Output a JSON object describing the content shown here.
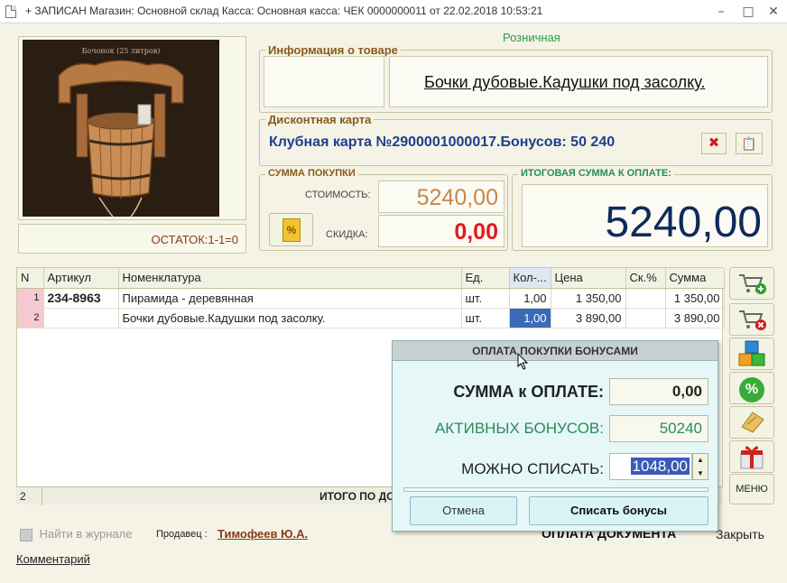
{
  "window": {
    "title": "+ ЗАПИСАН Магазин: Основной склад Касса: Основная касса: ЧЕК 0000000011 от 22.02.2018 10:53:21",
    "minimize": "–",
    "maximize": "□",
    "close": "✕"
  },
  "price_type": "Розничная",
  "product": {
    "photo_caption": "Бочонок (25 литров)",
    "stock_text": "ОСТАТОК:1-1=0",
    "info_legend": "Информация о товаре",
    "name": "Бочки дубовые.Кадушки под засолку."
  },
  "discount_card": {
    "legend": "Дисконтная карта",
    "text": "Клубная карта №2900001000017.Бонусов: 50 240"
  },
  "purchase": {
    "legend": "СУММА ПОКУПКИ",
    "cost_label": "СТОИМОСТЬ:",
    "cost_value": "5240,00",
    "discount_label": "СКИДКА:",
    "discount_value": "0,00"
  },
  "total": {
    "legend": "ИТОГОВАЯ СУММА К ОПЛАТЕ:",
    "value": "5240,00"
  },
  "table": {
    "headers": [
      "N",
      "Артикул",
      "Номенклатура",
      "Ед.",
      "Кол-...",
      "Цена",
      "Ск.%",
      "Сумма"
    ],
    "rows": [
      {
        "n": "1",
        "article": "234-8963",
        "name": "Пирамида - деревянная",
        "unit": "шт.",
        "qty": "1,00",
        "price": "1 350,00",
        "disc": "",
        "sum": "1 350,00"
      },
      {
        "n": "2",
        "article": "",
        "name": "Бочки дубовые.Кадушки под засолку.",
        "unit": "шт.",
        "qty": "1,00",
        "price": "3 890,00",
        "disc": "",
        "sum": "3 890,00"
      }
    ],
    "footer_count": "2",
    "footer_total_label": "ИТОГО ПО ДО"
  },
  "side_buttons": {
    "menu_label": "МЕНЮ"
  },
  "dialog": {
    "title": "ОПЛАТА ПОКУПКИ БОНУСАМИ",
    "sum_label": "СУММА к ОПЛАТЕ:",
    "sum_value": "0,00",
    "active_label": "АКТИВНЫХ БОНУСОВ:",
    "active_value": "50240",
    "can_label": "МОЖНО СПИСАТЬ:",
    "can_value": "1048,00",
    "cancel_label": "Отмена",
    "apply_label": "Списать бонусы"
  },
  "bottom": {
    "find_journal": "Найти в журнале",
    "seller_label": "Продавец :",
    "seller_name": "Тимофеев Ю.А.",
    "pay_document": "ОПЛАТА ДОКУМЕНТА",
    "close_label": "Закрыть",
    "comment_label": "Комментарий"
  },
  "colors": {
    "accent_blue": "#1f3f8f",
    "cost_orange": "#c8874a",
    "discount_red": "#e31a1a",
    "total_navy": "#0f2a5a",
    "bonus_green": "#2a8a5a",
    "seller_brown": "#8b3a1a"
  }
}
